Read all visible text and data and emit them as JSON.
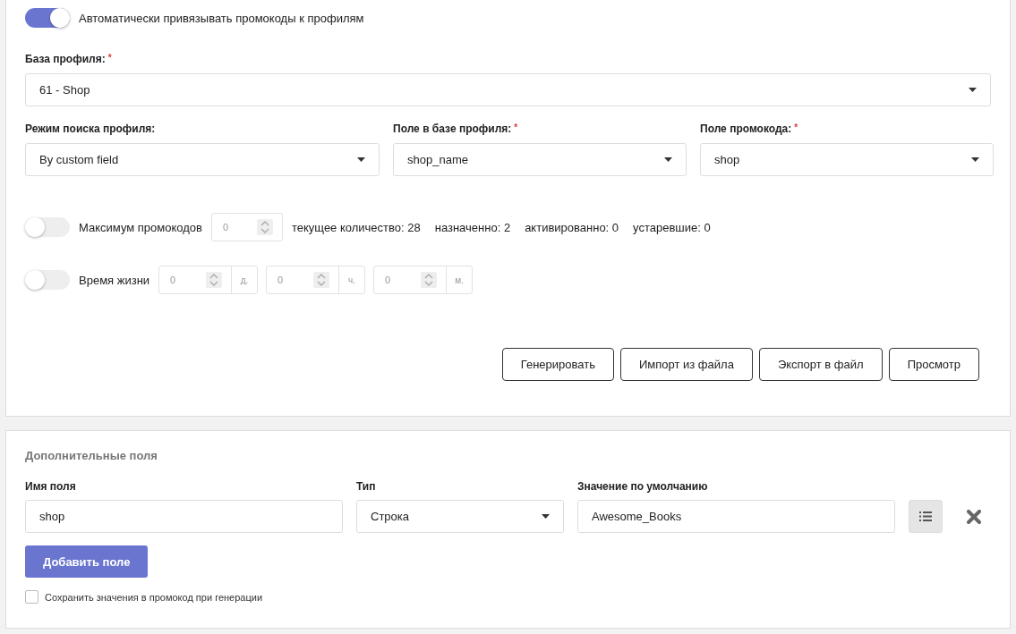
{
  "auto_bind": {
    "label": "Автоматически привязывать промокоды к профилям",
    "on": true
  },
  "profile_base": {
    "label": "База профиля:",
    "required_mark": "*",
    "value": "61 - Shop"
  },
  "search_fields": [
    {
      "label": "Режим поиска профиля:",
      "value": "By custom field"
    },
    {
      "label": "Поле в базе профиля:",
      "required_mark": "*",
      "value": "shop_name"
    },
    {
      "label": "Поле промокода:",
      "required_mark": "*",
      "value": "shop"
    }
  ],
  "max_promocodes": {
    "on": false,
    "label": "Максимум промокодов",
    "value": "0",
    "stats": [
      "текущее количество: 28",
      "назначенно: 2",
      "активированно: 0",
      "устаревшие: 0"
    ]
  },
  "lifetime": {
    "on": false,
    "label": "Время жизни",
    "parts": [
      {
        "value": "0",
        "unit": "д."
      },
      {
        "value": "0",
        "unit": "ч."
      },
      {
        "value": "0",
        "unit": "м."
      }
    ]
  },
  "buttons": [
    "Генерировать",
    "Импорт из файла",
    "Экспорт в файл",
    "Просмотр"
  ],
  "extra_fields": {
    "title": "Дополнительные поля",
    "columns": [
      "Имя поля",
      "Тип",
      "Значение по умолчанию"
    ],
    "rows": [
      {
        "name": "shop",
        "type": "Строка",
        "default": "Awesome_Books"
      }
    ],
    "add_button": "Добавить поле",
    "save_values": {
      "label": "Сохранить значения в промокод при генерации",
      "checked": false
    }
  }
}
